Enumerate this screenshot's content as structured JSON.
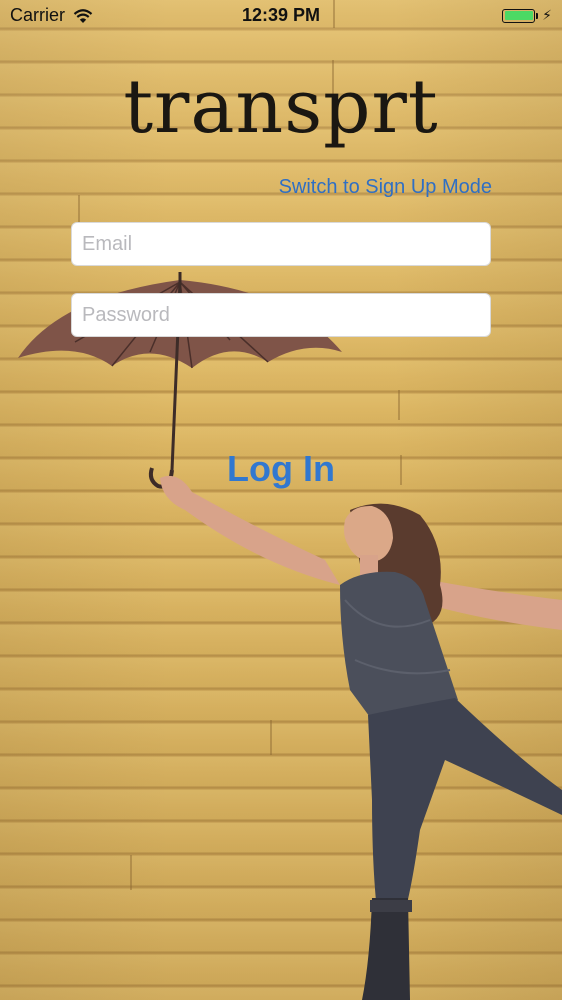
{
  "status_bar": {
    "carrier": "Carrier",
    "time": "12:39 PM",
    "wifi_icon": "wifi-icon",
    "battery_icon": "battery-icon",
    "charging_icon": "bolt-icon"
  },
  "app": {
    "title": "transprt",
    "switch_mode_label": "Switch to Sign Up Mode",
    "email_placeholder": "Email",
    "password_placeholder": "Password",
    "login_label": "Log In"
  },
  "colors": {
    "accent": "#3178d0",
    "wall": "#dcb766",
    "battery": "#4cd964"
  }
}
